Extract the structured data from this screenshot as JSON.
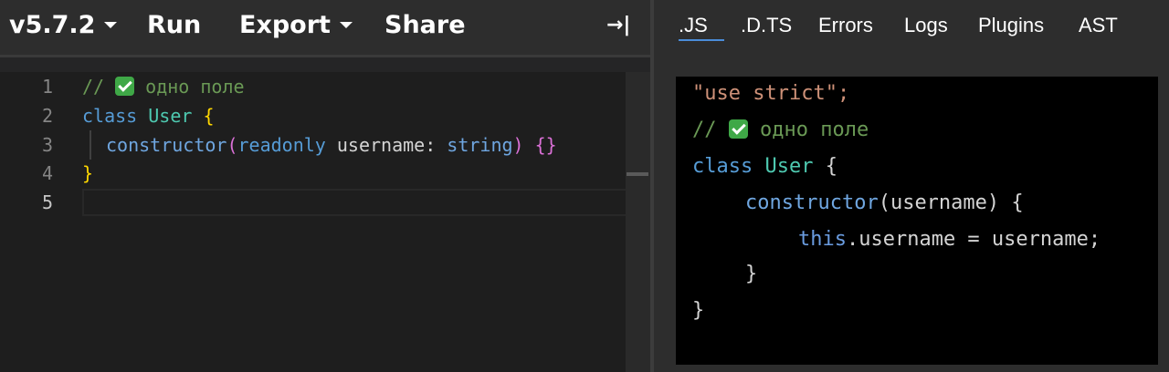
{
  "toolbar": {
    "version": "v5.7.2",
    "run": "Run",
    "export": "Export",
    "share": "Share",
    "collapse_icon": "→|"
  },
  "output_tabs": [
    ".JS",
    ".D.TS",
    "Errors",
    "Logs",
    "Plugins",
    "AST"
  ],
  "active_output_tab": ".JS",
  "editor": {
    "line_numbers": [
      "1",
      "2",
      "3",
      "4",
      "5"
    ],
    "active_line": "5",
    "line1": {
      "comment_prefix": "// ",
      "comment_text": " одно поле"
    },
    "line2": {
      "kw": "class",
      "name": "User",
      "brace": "{"
    },
    "line3": {
      "fn": "constructor",
      "open": "(",
      "mod": "readonly",
      "param": "username",
      "colon": ":",
      "type": "string",
      "close": ")",
      "body": "{}"
    },
    "line4": {
      "brace": "}"
    }
  },
  "output": {
    "line1": "\"use strict\";",
    "line2": {
      "comment_prefix": "// ",
      "comment_text": " одно поле"
    },
    "line3": {
      "kw": "class",
      "name": "User",
      "brace": "{"
    },
    "line4": {
      "fn": "constructor",
      "rest": "(username) {"
    },
    "line5": {
      "this": "this",
      "rest": ".username = username;"
    },
    "line6": "}",
    "line7": "}"
  },
  "colors": {
    "accent": "#4a8cd9",
    "comment": "#6a9955",
    "keyword": "#569cd6",
    "class_name": "#4ec9b0",
    "string": "#ce9178"
  }
}
